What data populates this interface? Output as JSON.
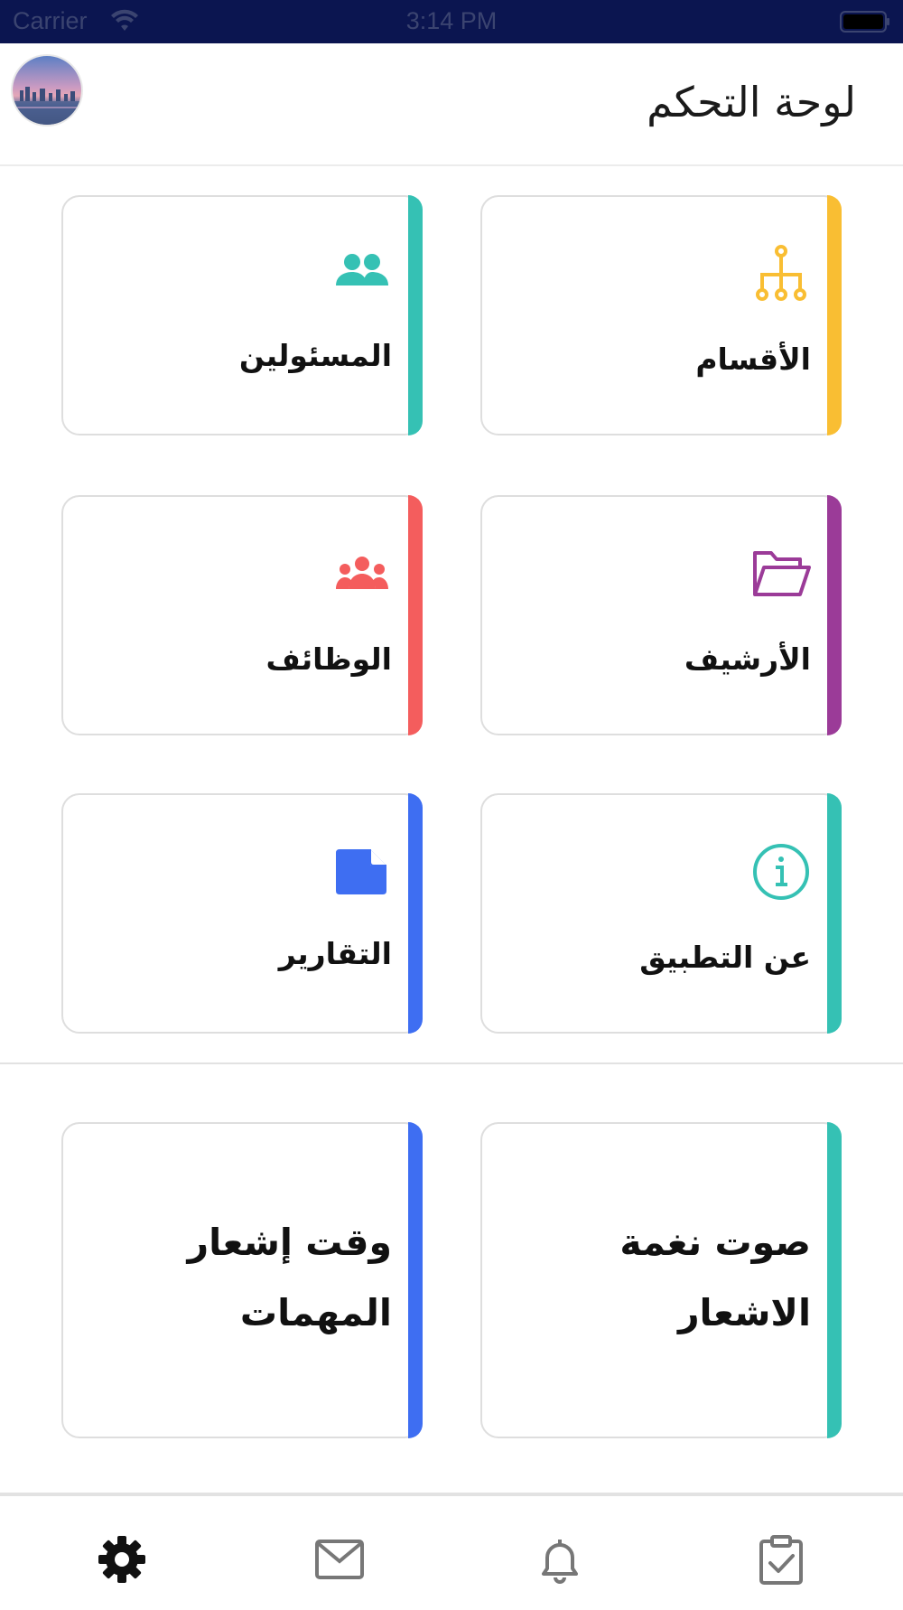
{
  "status_bar": {
    "carrier": "Carrier",
    "time": "3:14 PM"
  },
  "header": {
    "title": "لوحة التحكم"
  },
  "cards": {
    "departments": {
      "label": "الأقسام",
      "color": "#f9be33"
    },
    "officials": {
      "label": "المسئولين",
      "color": "#35c1b4"
    },
    "archive": {
      "label": "الأرشيف",
      "color": "#9b3b98"
    },
    "jobs": {
      "label": "الوظائف",
      "color": "#f45d5d"
    },
    "about": {
      "label": "عن التطبيق",
      "color": "#35c1b4"
    },
    "reports": {
      "label": "التقارير",
      "color": "#3e6ef2"
    },
    "notification_sound": {
      "label": "صوت نغمة الاشعار",
      "color": "#35c1b4"
    },
    "task_notification_time": {
      "label": "وقت إشعار المهمات",
      "color": "#3e6ef2"
    }
  },
  "tab_bar": {
    "items": [
      {
        "name": "tasks",
        "icon": "clipboard-check-icon"
      },
      {
        "name": "notifications",
        "icon": "bell-icon"
      },
      {
        "name": "messages",
        "icon": "envelope-icon"
      },
      {
        "name": "settings",
        "icon": "gear-icon",
        "active": true
      }
    ]
  }
}
